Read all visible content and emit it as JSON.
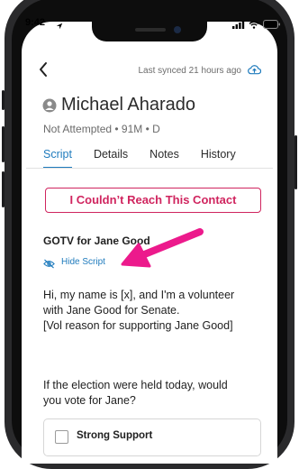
{
  "status_bar": {
    "time": "9:42"
  },
  "header": {
    "sync_text": "Last synced 21 hours ago"
  },
  "contact": {
    "name": "Michael Aharado",
    "meta": "Not Attempted • 91M • D"
  },
  "tabs": [
    {
      "label": "Script",
      "active": true
    },
    {
      "label": "Details",
      "active": false
    },
    {
      "label": "Notes",
      "active": false
    },
    {
      "label": "History",
      "active": false
    }
  ],
  "reach_button_label": "I Couldn’t Reach This Contact",
  "script": {
    "title": "GOTV for Jane Good",
    "hide_label": "Hide Script",
    "lines": [
      "Hi, my name is [x], and I'm a volunteer",
      "with Jane Good for Senate.",
      "[Vol reason for supporting Jane Good]"
    ]
  },
  "question": {
    "lines": [
      "If the election were held today, would",
      "you vote for Jane?"
    ],
    "options": [
      {
        "label": "Strong Support",
        "checked": false
      }
    ]
  },
  "colors": {
    "accent": "#1f7bbd",
    "alert": "#d0255f",
    "annotation_arrow": "#ec1a8c"
  },
  "icons": [
    "location-arrow-icon",
    "signal-icon",
    "wifi-icon",
    "battery-icon",
    "back-chevron-icon",
    "cloud-upload-icon",
    "person-avatar-icon",
    "eye-slash-icon",
    "annotation-arrow"
  ]
}
